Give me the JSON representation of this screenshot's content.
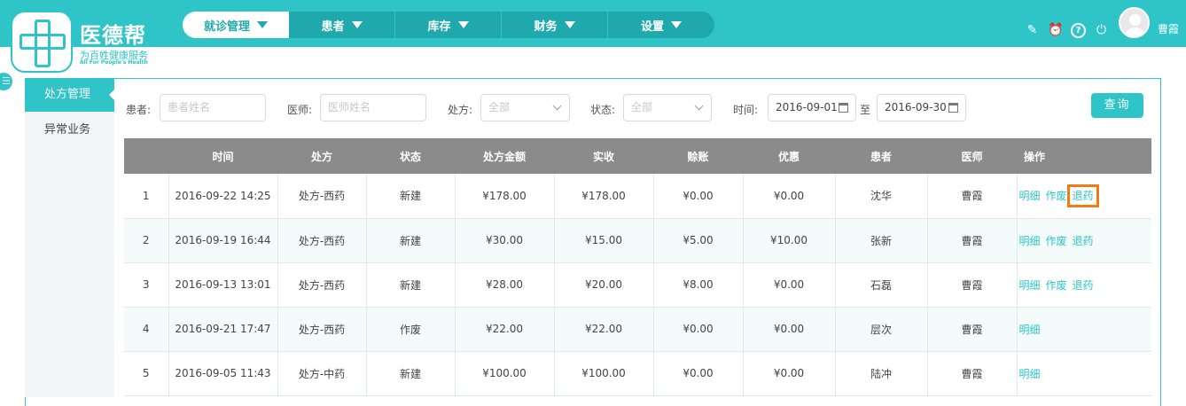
{
  "app": {
    "logo_title": "医德帮",
    "logo_sub": "为百姓健康服务",
    "logo_sub_en": "All For People's Health",
    "username": "曹霞"
  },
  "nav": [
    {
      "label": "就诊管理",
      "active": true
    },
    {
      "label": "患者"
    },
    {
      "label": "库存"
    },
    {
      "label": "财务"
    },
    {
      "label": "设置"
    }
  ],
  "toolbar_icons": [
    "edit-icon",
    "alarm-clock-icon",
    "help-icon",
    "power-icon"
  ],
  "sidebar": {
    "items": [
      {
        "label": "处方管理",
        "active": true
      },
      {
        "label": "异常业务"
      }
    ]
  },
  "filters": {
    "patient_label": "患者:",
    "patient_placeholder": "患者姓名",
    "doctor_label": "医师:",
    "doctor_placeholder": "医师姓名",
    "rx_label": "处方:",
    "rx_value": "全部",
    "status_label": "状态:",
    "status_value": "全部",
    "time_label": "时间:",
    "date_from": "2016-09-01",
    "to_label": "至",
    "date_to": "2016-09-30",
    "query_button": "查询"
  },
  "table": {
    "headers": [
      "",
      "时间",
      "处方",
      "状态",
      "处方金额",
      "实收",
      "赊账",
      "优惠",
      "患者",
      "医师",
      "操作"
    ],
    "rows": [
      {
        "no": "1",
        "time": "2016-09-22 14:25",
        "rx": "处方-西药",
        "status": "新建",
        "amount": "¥178.00",
        "received": "¥178.00",
        "credit": "¥0.00",
        "discount": "¥0.00",
        "patient": "沈华",
        "doctor": "曹霞",
        "ops": [
          "明细",
          "作废",
          "退药"
        ]
      },
      {
        "no": "2",
        "time": "2016-09-19 16:44",
        "rx": "处方-西药",
        "status": "新建",
        "amount": "¥30.00",
        "received": "¥15.00",
        "credit": "¥5.00",
        "discount": "¥10.00",
        "patient": "张新",
        "doctor": "曹霞",
        "ops": [
          "明细",
          "作废",
          "退药"
        ]
      },
      {
        "no": "3",
        "time": "2016-09-13 13:01",
        "rx": "处方-西药",
        "status": "新建",
        "amount": "¥28.00",
        "received": "¥20.00",
        "credit": "¥8.00",
        "discount": "¥0.00",
        "patient": "石磊",
        "doctor": "曹霞",
        "ops": [
          "明细",
          "作废",
          "退药"
        ]
      },
      {
        "no": "4",
        "time": "2016-09-21 17:47",
        "rx": "处方-西药",
        "status": "作废",
        "amount": "¥22.00",
        "received": "¥22.00",
        "credit": "¥0.00",
        "discount": "¥0.00",
        "patient": "层次",
        "doctor": "曹霞",
        "ops": [
          "明细"
        ]
      },
      {
        "no": "5",
        "time": "2016-09-05 11:43",
        "rx": "处方-中药",
        "status": "新建",
        "amount": "¥100.00",
        "received": "¥100.00",
        "credit": "¥0.00",
        "discount": "¥0.00",
        "patient": "陆冲",
        "doctor": "曹霞",
        "ops": [
          "明细"
        ]
      }
    ]
  }
}
